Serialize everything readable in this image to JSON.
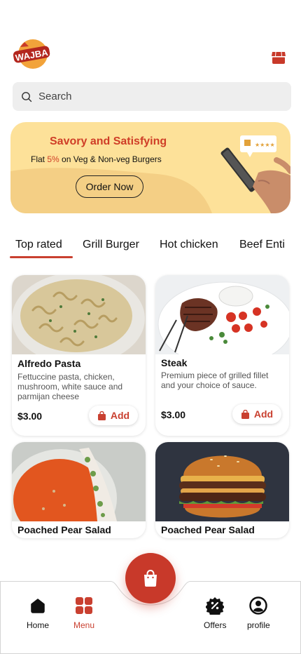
{
  "brand": {
    "logo_text": "WAJBA"
  },
  "search": {
    "placeholder": "Search"
  },
  "banner": {
    "title": "Savory and Satisfying",
    "sub_prefix": "Flat ",
    "sub_percent": "5%",
    "sub_suffix": " on Veg & Non-veg Burgers",
    "cta": "Order Now",
    "rating": 5
  },
  "tabs": [
    {
      "label": "Top rated",
      "active": true
    },
    {
      "label": "Grill Burger",
      "active": false
    },
    {
      "label": "Hot chicken",
      "active": false
    },
    {
      "label": "Beef Enti",
      "active": false
    }
  ],
  "menu_items": [
    {
      "name": "Alfredo Pasta",
      "desc": "Fettuccine pasta, chicken, mushroom, white sauce and parmijan cheese",
      "price": "$3.00",
      "add_label": "Add",
      "image": "alfredo-pasta"
    },
    {
      "name": "Steak",
      "desc": "Premium piece of grilled fillet and your choice of sauce.",
      "price": "$3.00",
      "add_label": "Add",
      "image": "steak"
    },
    {
      "name": "Poached Pear Salad",
      "image": "pear-salad"
    },
    {
      "name": "Poached Pear Salad",
      "image": "burger"
    }
  ],
  "nav": [
    {
      "label": "Home",
      "icon": "home-icon",
      "active": false
    },
    {
      "label": "Menu",
      "icon": "grid-icon",
      "active": true
    },
    {
      "label": "Offers",
      "icon": "discount-icon",
      "active": false
    },
    {
      "label": "profile",
      "icon": "user-icon",
      "active": false
    }
  ],
  "colors": {
    "accent": "#c94030",
    "banner_bg": "#fde199",
    "banner_wave": "#f4cf85"
  }
}
